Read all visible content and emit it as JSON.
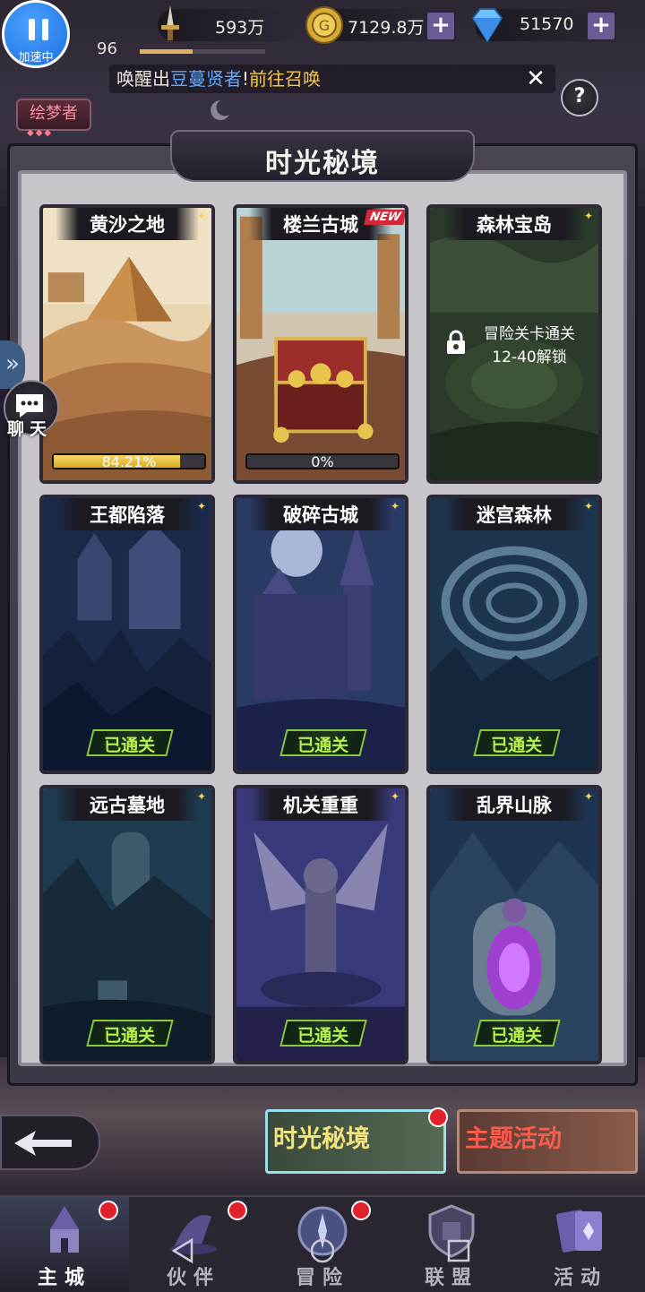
{
  "top_bar": {
    "power": "593万",
    "gold": "7129.8万",
    "diamonds": "51570",
    "level": "96",
    "exp_progress": 0.42,
    "speed_label": "加速中"
  },
  "notice": {
    "prefix": "唤醒出",
    "hero": "豆蔓贤者",
    "mid": "!",
    "link": "前往召唤"
  },
  "player_badge": "绘梦者",
  "help_icon": "?",
  "page_title": "时光秘境",
  "cards": [
    {
      "title": "黄沙之地",
      "status": "progress",
      "progress_text": "84.21%",
      "progress": 0.8421
    },
    {
      "title": "楼兰古城",
      "status": "progress",
      "progress_text": "0%",
      "progress": 0,
      "tag": "NEW"
    },
    {
      "title": "森林宝岛",
      "status": "locked",
      "lock_line1": "冒险关卡通关",
      "lock_line2": "12-40解锁"
    },
    {
      "title": "王都陷落",
      "status": "cleared",
      "cleared_text": "已通关"
    },
    {
      "title": "破碎古城",
      "status": "cleared",
      "cleared_text": "已通关"
    },
    {
      "title": "迷宫森林",
      "status": "cleared",
      "cleared_text": "已通关"
    },
    {
      "title": "远古墓地",
      "status": "cleared",
      "cleared_text": "已通关"
    },
    {
      "title": "机关重重",
      "status": "cleared",
      "cleared_text": "已通关"
    },
    {
      "title": "乱界山脉",
      "status": "cleared",
      "cleared_text": "已通关"
    }
  ],
  "side": {
    "chat_label": "聊天"
  },
  "bottom_tabs": [
    {
      "label": "时光秘境",
      "color": "#f4e27a"
    },
    {
      "label": "主题活动",
      "color": "#ff5a4a"
    }
  ],
  "nav": [
    {
      "label": "主城",
      "badge": true,
      "active": true
    },
    {
      "label": "伙伴",
      "badge": true,
      "active": false
    },
    {
      "label": "冒险",
      "badge": true,
      "active": false
    },
    {
      "label": "联盟",
      "badge": false,
      "active": false
    },
    {
      "label": "活动",
      "badge": false,
      "active": false
    }
  ],
  "icons": {
    "power": "sword-icon",
    "gold": "coin-icon",
    "diamond": "diamond-icon",
    "close": "close-icon",
    "help": "help-icon",
    "chat": "chat-icon",
    "back": "back-arrow-icon"
  },
  "colors": {
    "accent_gold": "#f4d35e",
    "cleared_green": "#b6f24e",
    "new_red": "#d2293a",
    "link_blue": "#5fa8ff"
  }
}
